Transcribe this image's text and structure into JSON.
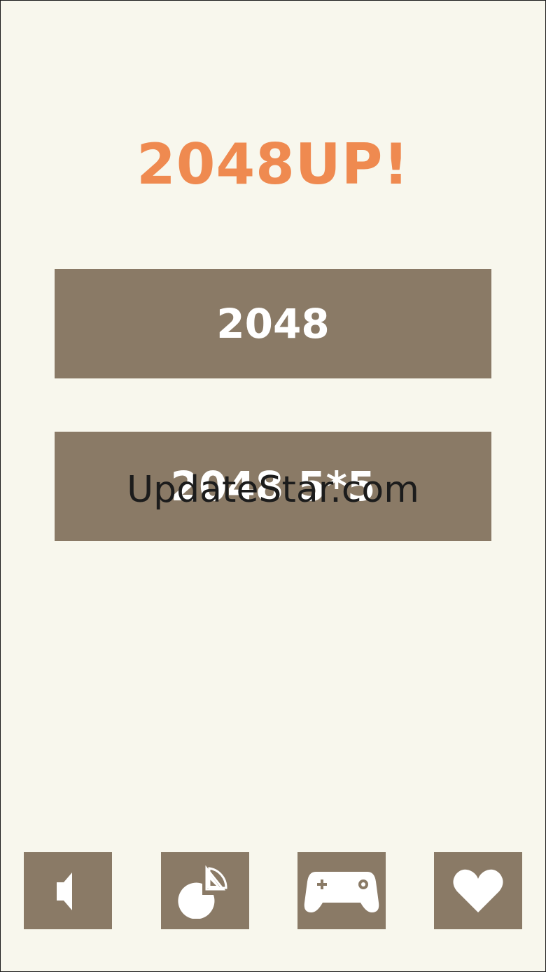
{
  "app": {
    "title": "2048UP!"
  },
  "modes": [
    {
      "label": "2048"
    },
    {
      "label": "2048 5*5"
    }
  ],
  "watermark": "UpdateStar.com",
  "bottom_bar": [
    {
      "icon": "speaker-icon"
    },
    {
      "icon": "pie-chart-icon"
    },
    {
      "icon": "gamepad-icon"
    },
    {
      "icon": "heart-icon"
    }
  ],
  "colors": {
    "background": "#f8f7ed",
    "title": "#ef8a50",
    "button": "#8a7a66",
    "button_text": "#ffffff"
  }
}
